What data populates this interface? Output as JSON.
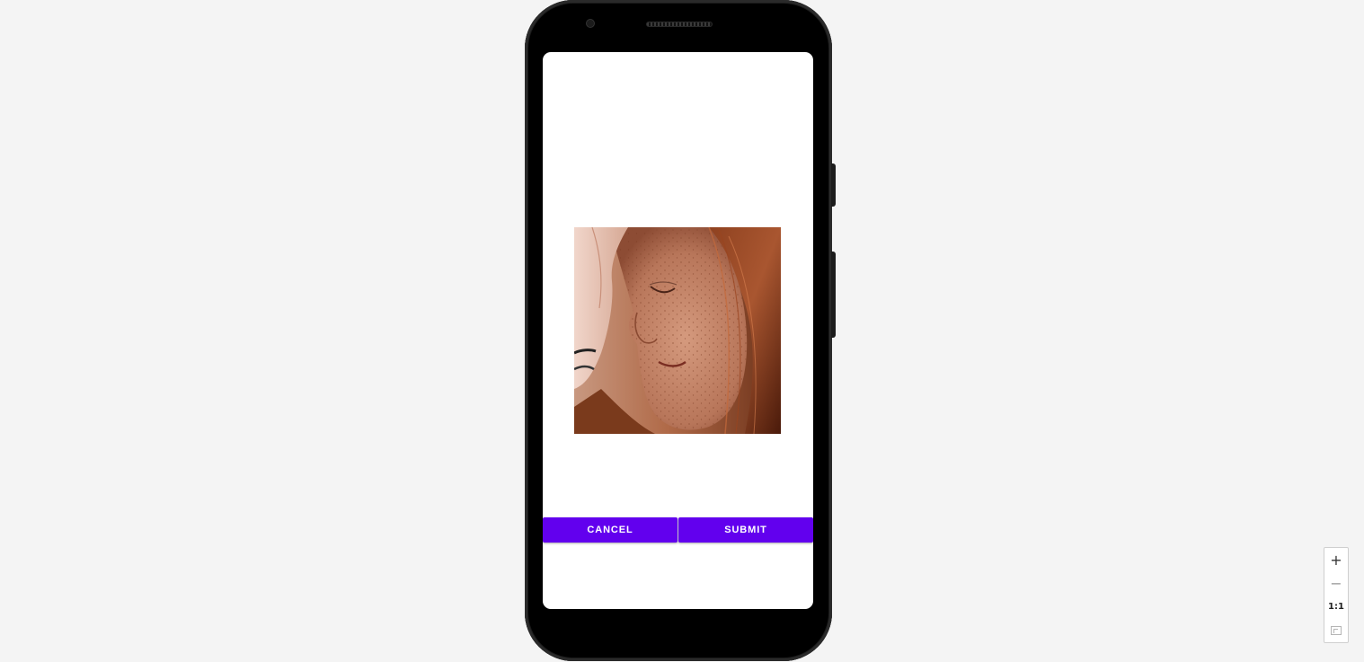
{
  "dialog": {
    "cancel_label": "CANCEL",
    "submit_label": "SUBMIT",
    "accent_color": "#6200ee"
  },
  "image": {
    "subject": "freckled-woman-portrait-photo"
  },
  "zoom_controls": {
    "zoom_in_label": "+",
    "zoom_out_label": "−",
    "actual_size_label": "1:1",
    "fit_icon": "fit-to-screen-icon"
  }
}
